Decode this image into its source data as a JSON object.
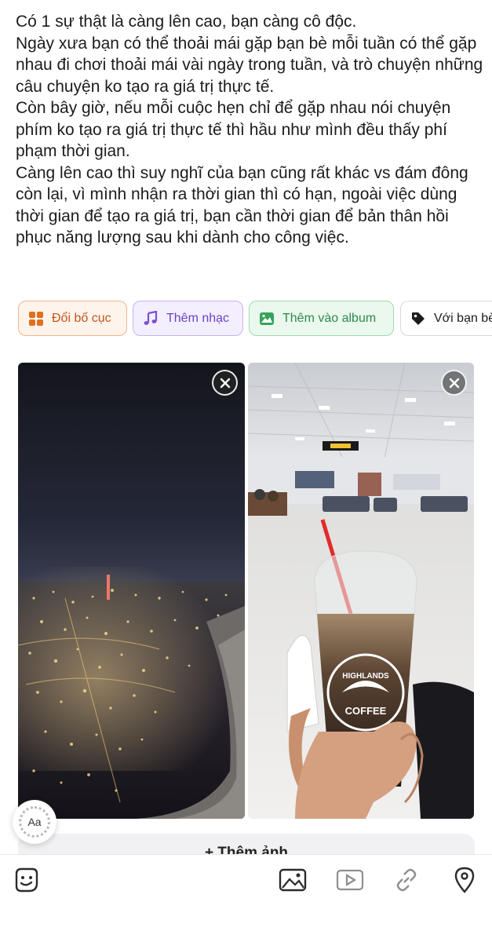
{
  "post": {
    "text": "Có 1 sự thật là càng lên cao, bạn càng cô độc.\nNgày xưa bạn có thể thoải mái gặp bạn bè mỗi tuần có thể gặp nhau đi chơi thoải mái vài ngày trong tuần, và trò chuyện những câu chuyện ko tạo ra giá trị thực tế.\nCòn bây giờ, nếu mỗi cuộc hẹn chỉ để gặp nhau nói chuyện phím ko tạo ra giá trị thực tế thì hầu như mình đều thấy phí phạm thời gian.\nCàng lên cao thì suy nghĩ của bạn cũng rất khác vs đám đông còn lại, vì mình nhận ra thời gian thì có hạn, ngoài việc dùng thời gian để tạo ra giá trị, bạn cần thời gian để bản thân hồi phục năng lượng sau khi dành cho công việc."
  },
  "chips": {
    "layout": {
      "label": "Đổi bố cục",
      "icon": "grid-icon",
      "color": "#c1551a"
    },
    "music": {
      "label": "Thêm nhạc",
      "icon": "music-note-icon",
      "color": "#6a43c6"
    },
    "album": {
      "label": "Thêm vào album",
      "icon": "album-image-icon",
      "color": "#2e8a4c"
    },
    "friends": {
      "label": "Với bạn bè",
      "icon": "tag-icon",
      "color": "#1c1c1e"
    }
  },
  "photos": [
    {
      "icon": "close-icon"
    },
    {
      "icon": "close-icon"
    }
  ],
  "photo2": {
    "cup_text_top": "HIGHLANDS",
    "cup_text_bottom": "COFFEE"
  },
  "text_style_badge": {
    "label": "Aa"
  },
  "add_photo": {
    "label": "+ Thêm ảnh"
  },
  "toolbar": {
    "items": [
      "sticker-icon",
      "image-icon",
      "video-icon",
      "link-icon",
      "location-icon"
    ]
  }
}
